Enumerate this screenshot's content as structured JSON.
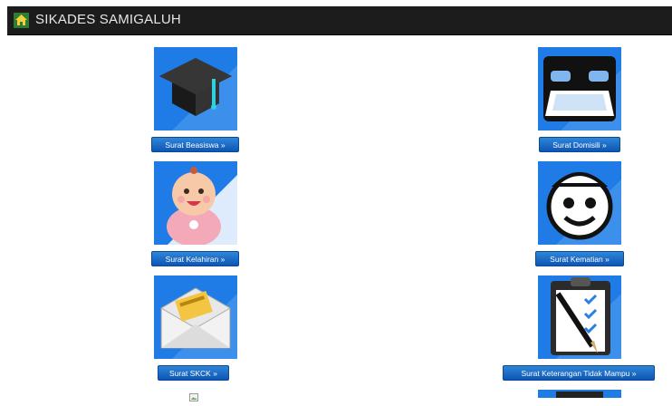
{
  "app": {
    "title": "SIKADES SAMIGALUH"
  },
  "services": [
    {
      "label": "Surat Beasiswa »",
      "icon": "graduation-cap-icon"
    },
    {
      "label": "Surat Domisili »",
      "icon": "bed-icon"
    },
    {
      "label": "Surat Kelahiran »",
      "icon": "baby-icon"
    },
    {
      "label": "Surat Kematian »",
      "icon": "face-icon"
    },
    {
      "label": "Surat SKCK »",
      "icon": "envelope-icon"
    },
    {
      "label": "Surat Keterangan Tidak Mampu »",
      "icon": "clipboard-checklist-icon"
    }
  ],
  "colors": {
    "tile_background": "#1f7be6",
    "button": "#1565c0",
    "navbar": "#1c1c1c"
  }
}
